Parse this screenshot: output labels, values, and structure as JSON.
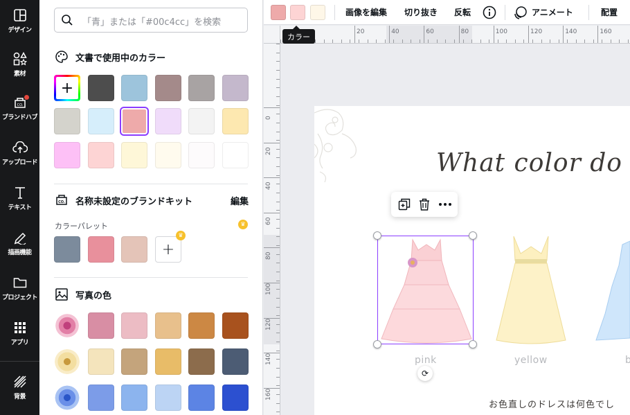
{
  "rail": {
    "items": [
      {
        "label": "デザイン",
        "icon": "layout-icon"
      },
      {
        "label": "素材",
        "icon": "elements-icon"
      },
      {
        "label": "ブランドハブ",
        "icon": "brand-hub-icon"
      },
      {
        "label": "アップロード",
        "icon": "upload-icon"
      },
      {
        "label": "テキスト",
        "icon": "text-icon"
      },
      {
        "label": "描画機能",
        "icon": "draw-icon"
      },
      {
        "label": "プロジェクト",
        "icon": "folder-icon"
      },
      {
        "label": "アプリ",
        "icon": "apps-icon"
      },
      {
        "label": "背景",
        "icon": "background-icon"
      }
    ]
  },
  "panel": {
    "search_placeholder": "「青」または「#00c4cc」を検索",
    "doc_colors": {
      "title": "文書で使用中のカラー",
      "colors": [
        "#4d4d4d",
        "#9dc4dc",
        "#a48a8a",
        "#a8a3a3",
        "#c4b8cc",
        "#d4d3cc",
        "#d6eefb",
        "#eeaaaa",
        "#f0dcfa",
        "#f3f3f3",
        "#fde8b0",
        "#fdc0f6",
        "#fdd4d4",
        "#fef7d8",
        "#fffbee",
        "#fdfbfc",
        "#ffffff"
      ],
      "selected_color": "#eeaaaa"
    },
    "brand_kit": {
      "title": "名称未設定のブランドキット",
      "edit_label": "編集",
      "palette_label": "カラーパレット",
      "colors": [
        "#7c8b9c",
        "#e8909c",
        "#e4c4b8"
      ]
    },
    "photo_colors": {
      "title": "写真の色",
      "rows": [
        {
          "thumb": "pink-flower",
          "colors": [
            "#d88ea4",
            "#ecbcc4",
            "#e8c08c",
            "#cc8844",
            "#a8521e"
          ]
        },
        {
          "thumb": "yellow-flower",
          "colors": [
            "#f4e4bc",
            "#c4a47c",
            "#e8bc68",
            "#8c6c4c",
            "#4c5c74"
          ]
        },
        {
          "thumb": "blue-flower",
          "colors": [
            "#7c9ce8",
            "#8cb4ee",
            "#bcd4f4",
            "#5c84e4",
            "#2c50d0"
          ]
        }
      ]
    }
  },
  "toolbar": {
    "swatches": [
      "#eeaaaa",
      "#fdd4d4",
      "#fef7e8"
    ],
    "buttons": [
      "画像を編集",
      "切り抜き",
      "反転"
    ],
    "animate_label": "アニメート",
    "position_label": "配置",
    "tooltip": "カラー"
  },
  "ruler": {
    "top_numbers": [
      "20",
      "40",
      "60",
      "80",
      "100",
      "120",
      "140",
      "160"
    ],
    "left_numbers": [
      "0",
      "20",
      "40",
      "60",
      "80",
      "100",
      "120",
      "140",
      "160"
    ]
  },
  "canvas": {
    "title": "What color do you",
    "dress_labels": [
      "pink",
      "yellow",
      "b"
    ],
    "bottom_text": "お色直しのドレスは何色でし"
  }
}
